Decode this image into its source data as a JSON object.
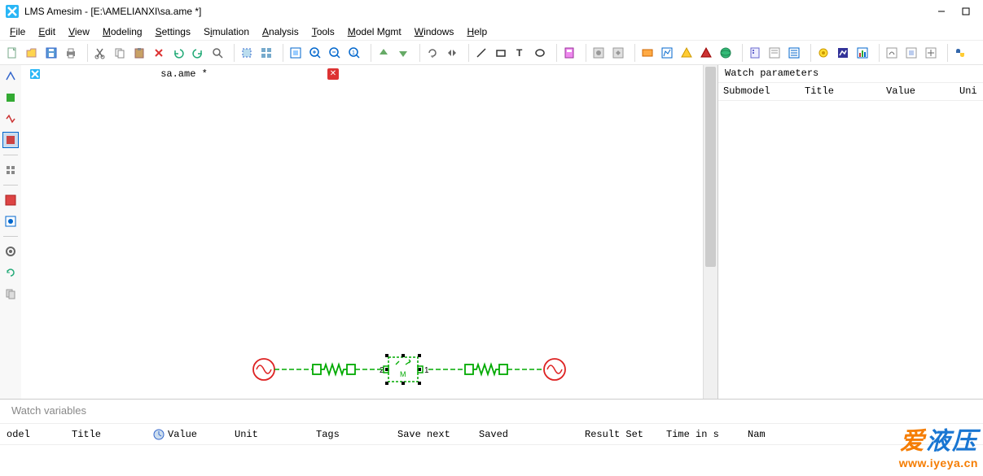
{
  "window": {
    "title": "LMS Amesim - [E:\\AMELIANXI\\sa.ame *]"
  },
  "menubar": {
    "items": [
      {
        "label": "File",
        "u": "F"
      },
      {
        "label": "Edit",
        "u": "E"
      },
      {
        "label": "View",
        "u": "V"
      },
      {
        "label": "Modeling",
        "u": "M"
      },
      {
        "label": "Settings",
        "u": "S"
      },
      {
        "label": "Simulation",
        "u": "S"
      },
      {
        "label": "Analysis",
        "u": "A"
      },
      {
        "label": "Tools",
        "u": "T"
      },
      {
        "label": "Model Mgmt",
        "u": "M"
      },
      {
        "label": "Windows",
        "u": "W"
      },
      {
        "label": "Help",
        "u": "H"
      }
    ]
  },
  "tab": {
    "name": "sa.ame *"
  },
  "watch_params": {
    "title": "Watch parameters",
    "columns": [
      "Submodel",
      "Title",
      "Value",
      "Uni"
    ]
  },
  "watch_vars": {
    "title": "Watch variables",
    "columns": [
      "odel",
      "Title",
      "Value",
      "Unit",
      "Tags",
      "Save next",
      "Saved",
      "Result Set",
      "Time in s",
      "Nam"
    ]
  },
  "diagram": {
    "ports": {
      "left": "2",
      "right": "1"
    },
    "center_label": "M"
  },
  "watermark": {
    "cn": "爱液压",
    "url": "www.iyeya.cn"
  }
}
